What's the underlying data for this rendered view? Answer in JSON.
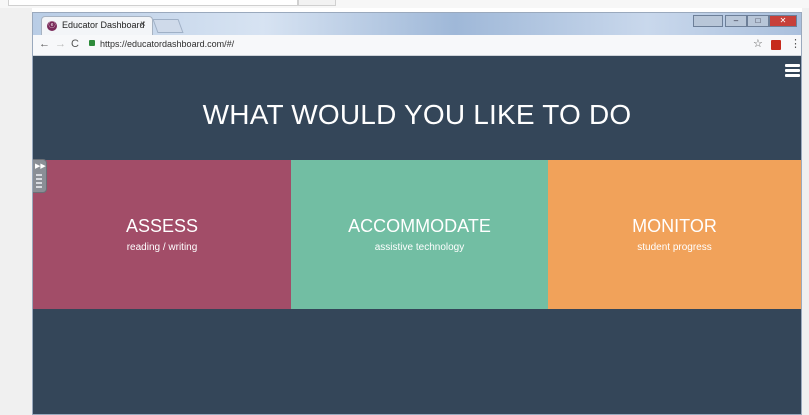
{
  "browser": {
    "tab_title": "Educator Dashboard",
    "tab_close": "×",
    "url": "https://educatordashboard.com/#/",
    "nav_back": "←",
    "nav_forward": "→",
    "nav_reload": "C",
    "bookmark_star": "☆",
    "menu_dots": "⋮",
    "window_close": "✕",
    "window_min": "–",
    "window_max": "□"
  },
  "page": {
    "headline": "WHAT WOULD YOU LIKE TO DO",
    "panels": [
      {
        "title": "ASSESS",
        "subtitle": "reading / writing",
        "color": "#a24d68"
      },
      {
        "title": "ACCOMMODATE",
        "subtitle": "assistive technology",
        "color": "#72bea3"
      },
      {
        "title": "MONITOR",
        "subtitle": "student progress",
        "color": "#f1a25a"
      }
    ],
    "background_color": "#344659"
  },
  "icons": {
    "menu": "hamburger-menu-icon",
    "favicon": "educator-favicon-icon",
    "secure": "lock-icon",
    "pdf": "pdf-extension-icon"
  }
}
